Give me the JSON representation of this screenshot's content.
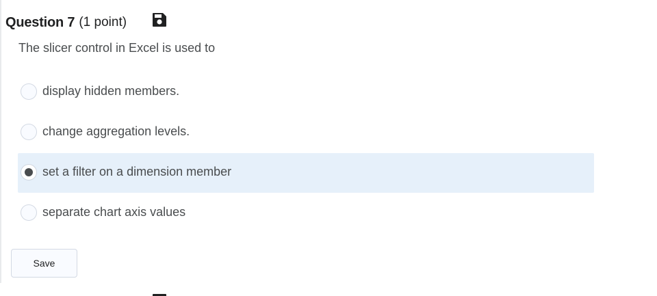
{
  "question": {
    "title": "Question 7",
    "points": "(1 point)",
    "save_icon": "floppy-disk-icon",
    "prompt": "The slicer control in Excel is used to"
  },
  "options": [
    {
      "label": "display hidden members.",
      "selected": false
    },
    {
      "label": "change aggregation levels.",
      "selected": false
    },
    {
      "label": "set a filter on a dimension member",
      "selected": true
    },
    {
      "label": "separate chart axis values",
      "selected": false
    }
  ],
  "actions": {
    "save_label": "Save"
  },
  "colors": {
    "selected_row": "#e6f0fa",
    "text": "#494c4e",
    "heading": "#202122"
  }
}
